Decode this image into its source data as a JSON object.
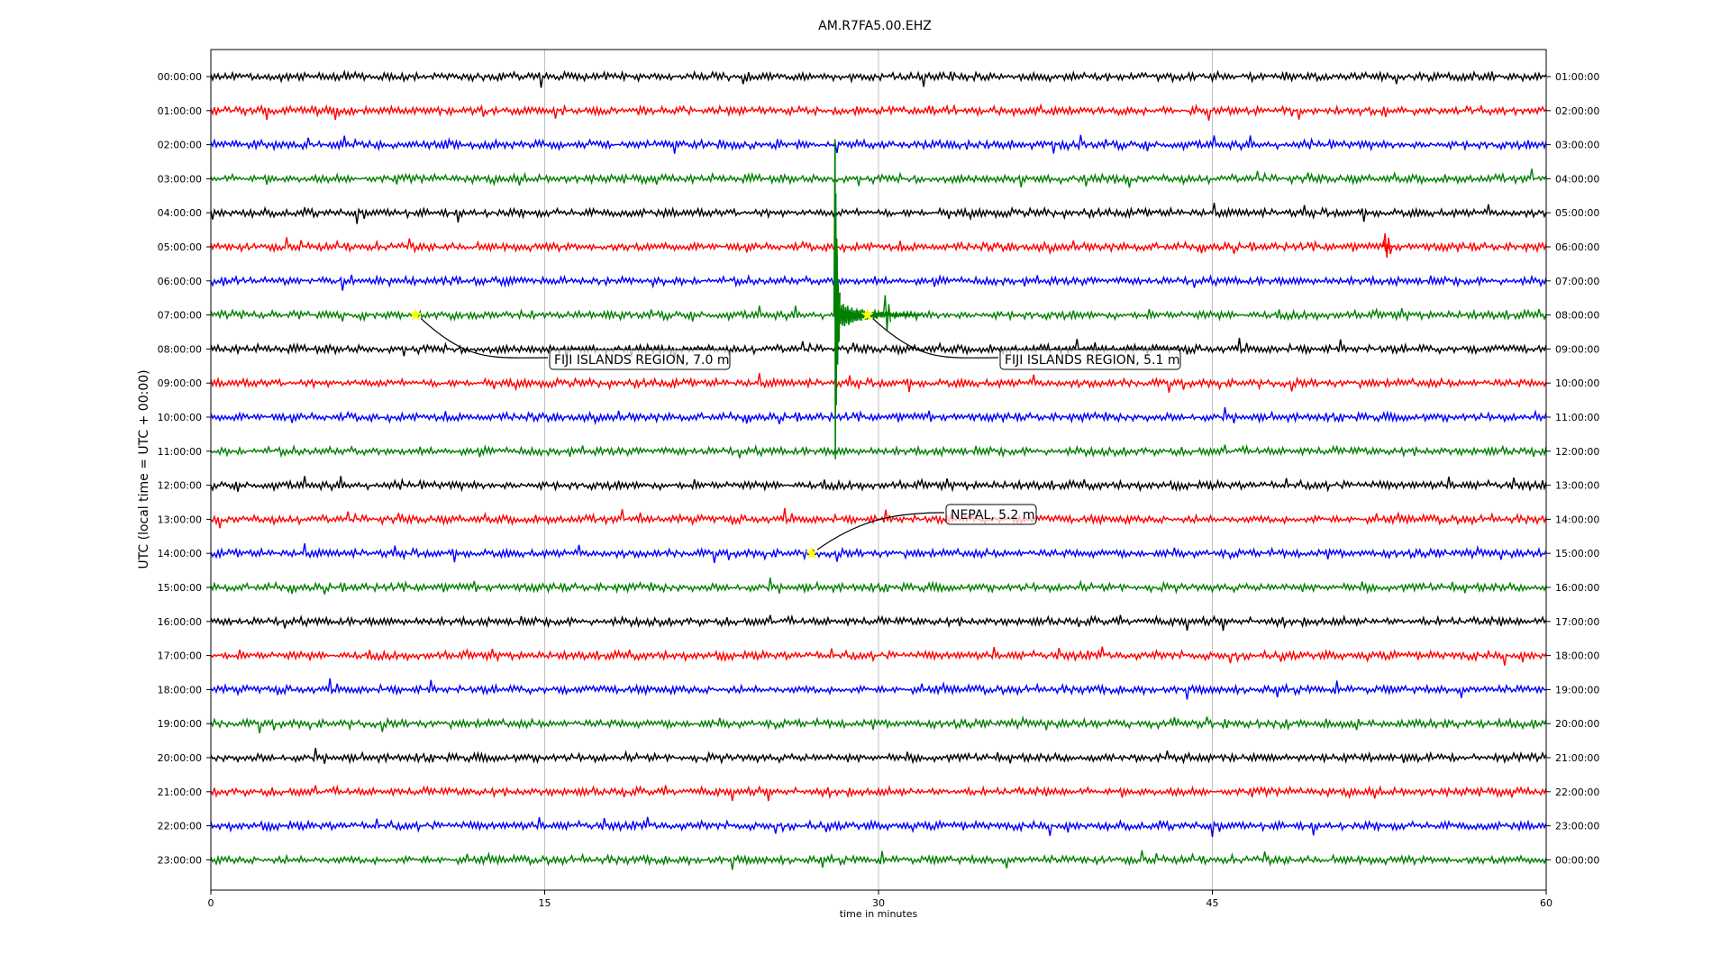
{
  "chart_data": {
    "type": "line",
    "title": "AM.R7FA5.00.EHZ",
    "xlabel": "time in minutes",
    "ylabel": "UTC (local time = UTC + 00:00)",
    "xlim": [
      0,
      60
    ],
    "x_ticks": [
      "0",
      "15",
      "30",
      "45",
      "60"
    ],
    "x_tick_values": [
      0,
      15,
      30,
      45,
      60
    ],
    "vertical_gridlines_at": [
      15,
      30,
      45
    ],
    "series_colors": [
      "#000000",
      "#ff0000",
      "#0000ff",
      "#008000"
    ],
    "rows": [
      {
        "left": "00:00:00",
        "right": "01:00:00"
      },
      {
        "left": "01:00:00",
        "right": "02:00:00"
      },
      {
        "left": "02:00:00",
        "right": "03:00:00"
      },
      {
        "left": "03:00:00",
        "right": "04:00:00"
      },
      {
        "left": "04:00:00",
        "right": "05:00:00"
      },
      {
        "left": "05:00:00",
        "right": "06:00:00"
      },
      {
        "left": "06:00:00",
        "right": "07:00:00"
      },
      {
        "left": "07:00:00",
        "right": "08:00:00"
      },
      {
        "left": "08:00:00",
        "right": "09:00:00"
      },
      {
        "left": "09:00:00",
        "right": "10:00:00"
      },
      {
        "left": "10:00:00",
        "right": "11:00:00"
      },
      {
        "left": "11:00:00",
        "right": "12:00:00"
      },
      {
        "left": "12:00:00",
        "right": "13:00:00"
      },
      {
        "left": "13:00:00",
        "right": "14:00:00"
      },
      {
        "left": "14:00:00",
        "right": "15:00:00"
      },
      {
        "left": "15:00:00",
        "right": "16:00:00"
      },
      {
        "left": "16:00:00",
        "right": "17:00:00"
      },
      {
        "left": "17:00:00",
        "right": "18:00:00"
      },
      {
        "left": "18:00:00",
        "right": "19:00:00"
      },
      {
        "left": "19:00:00",
        "right": "20:00:00"
      },
      {
        "left": "20:00:00",
        "right": "21:00:00"
      },
      {
        "left": "21:00:00",
        "right": "22:00:00"
      },
      {
        "left": "22:00:00",
        "right": "23:00:00"
      },
      {
        "left": "23:00:00",
        "right": "00:00:00"
      }
    ],
    "events": [
      {
        "label": "FIJI ISLANDS REGION, 7.0 m",
        "row": 7,
        "minute": 9.2,
        "marker_color": "#ffff00"
      },
      {
        "label": "FIJI ISLANDS REGION, 5.1 m",
        "row": 7,
        "minute": 29.5,
        "marker_color": "#ffff00"
      },
      {
        "label": "NEPAL, 5.2 m",
        "row": 14,
        "minute": 27.0,
        "marker_color": "#ffff00"
      }
    ],
    "notable_signals": [
      {
        "row": 7,
        "minute": 28.0,
        "description": "large earthquake arrival spanning rows 2–11"
      },
      {
        "row": 5,
        "minute": 52.8,
        "description": "short spike"
      }
    ],
    "grid": true
  }
}
